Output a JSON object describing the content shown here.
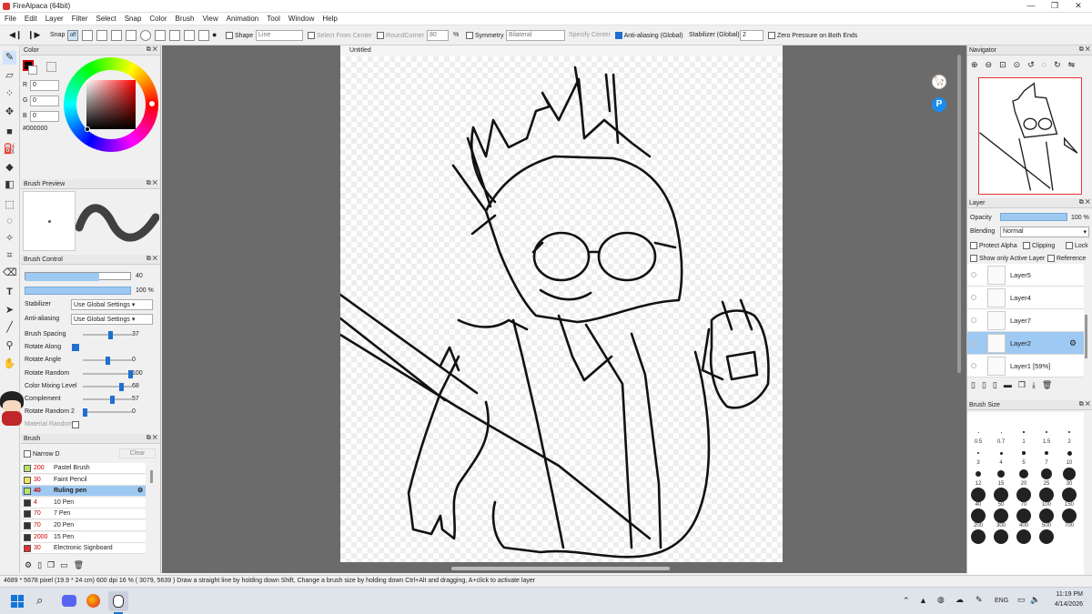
{
  "app": {
    "title": "FireAlpaca (64bit)"
  },
  "menu": [
    "File",
    "Edit",
    "Layer",
    "Filter",
    "Select",
    "Snap",
    "Color",
    "Brush",
    "View",
    "Animation",
    "Tool",
    "Window",
    "Help"
  ],
  "toolbar": {
    "snap_label": "Snap",
    "snap_off": "off",
    "shape_label": "Shape",
    "shape_value": "Line",
    "select_from_center": "Select From Center",
    "round_corner": "RoundCorner",
    "round_corner_value": "80",
    "percent": "%",
    "symmetry": "Symmetry",
    "symmetry_value": "Bilateral",
    "specify_center": "Specify Center",
    "antialiasing": "Anti-aliasing (Global)",
    "stabilizer": "Stabilizer (Global)",
    "stabilizer_value": "2",
    "zero_pressure": "Zero Pressure on Both Ends"
  },
  "color_panel": {
    "title": "Color",
    "r_label": "R",
    "r": "0",
    "g_label": "G",
    "g": "0",
    "b_label": "B",
    "b": "0",
    "hex": "#000000"
  },
  "brush_preview": {
    "title": "Brush Preview"
  },
  "brush_control": {
    "title": "Brush Control",
    "size": "40",
    "opacity": "100 %",
    "size_fill": 0.7,
    "stabilizer_label": "Stabilizer",
    "stabilizer_value": "Use Global Settings",
    "antialias_label": "Anti-aliasing",
    "antialias_value": "Use Global Settings",
    "rows": [
      {
        "label": "Brush Spacing",
        "value": "37",
        "pos": 0.55
      },
      {
        "label": "Rotate Along",
        "value": "",
        "pos": -1
      },
      {
        "label": "Rotate Angle",
        "value": "0",
        "pos": 0.5
      },
      {
        "label": "Rotate Random",
        "value": "100",
        "pos": 1.0
      },
      {
        "label": "Color Mixing Level",
        "value": "68",
        "pos": 0.8
      },
      {
        "label": "Complement",
        "value": "57",
        "pos": 0.6
      },
      {
        "label": "Rotate Random 2",
        "value": "0",
        "pos": 0.0
      },
      {
        "label": "Material Random",
        "value": "",
        "pos": -2
      }
    ]
  },
  "brush_list": {
    "title": "Brush",
    "narrow_label": "Narrow D",
    "clear_label": "Clear",
    "items": [
      {
        "size": "200",
        "name": "Pastel Brush",
        "color": "#b7e36b"
      },
      {
        "size": "30",
        "name": "Faint Pencil",
        "color": "#f5e25b"
      },
      {
        "size": "40",
        "name": "Ruling pen",
        "color": "#b7e36b"
      },
      {
        "size": "4",
        "name": "10 Pen",
        "color": "#333333"
      },
      {
        "size": "70",
        "name": "7 Pen",
        "color": "#333333"
      },
      {
        "size": "70",
        "name": "20 Pen",
        "color": "#333333"
      },
      {
        "size": "2000",
        "name": "15 Pen",
        "color": "#333333"
      },
      {
        "size": "30",
        "name": "Electronic Signboard",
        "color": "#e03030"
      }
    ]
  },
  "document": {
    "tab": "Untitled"
  },
  "navigator": {
    "title": "Navigator"
  },
  "layer_panel": {
    "title": "Layer",
    "opacity_label": "Opacity",
    "opacity_value": "100 %",
    "blending_label": "Blending",
    "blending_value": "Normal",
    "protect_alpha": "Protect Alpha",
    "clipping": "Clipping",
    "lock": "Lock",
    "show_only_active": "Show only Active Layer",
    "reference": "Reference",
    "layers": [
      "Layer5",
      "Layer4",
      "Layer7",
      "Layer2",
      "Layer1 [59%]"
    ],
    "selected": "Layer2"
  },
  "brush_size": {
    "title": "Brush Size",
    "sizes": [
      "0.5",
      "0.7",
      "1",
      "1.5",
      "2",
      "3",
      "4",
      "5",
      "7",
      "10",
      "12",
      "15",
      "20",
      "25",
      "30",
      "40",
      "50",
      "70",
      "100",
      "150",
      "200",
      "300",
      "400",
      "500",
      "700",
      "",
      "",
      "",
      ""
    ]
  },
  "status": {
    "text": "4689 * 5678 pixel  (19.9 * 24 cm)  600 dpi  16 %  ( 3079, 5639 )  Draw a straight line by holding down Shift, Change a brush size by holding down Ctrl+Alt and dragging, A+click to activate layer"
  },
  "taskbar": {
    "lang": "ENG",
    "time": "11:19 PM",
    "date": "4/14/2026"
  }
}
